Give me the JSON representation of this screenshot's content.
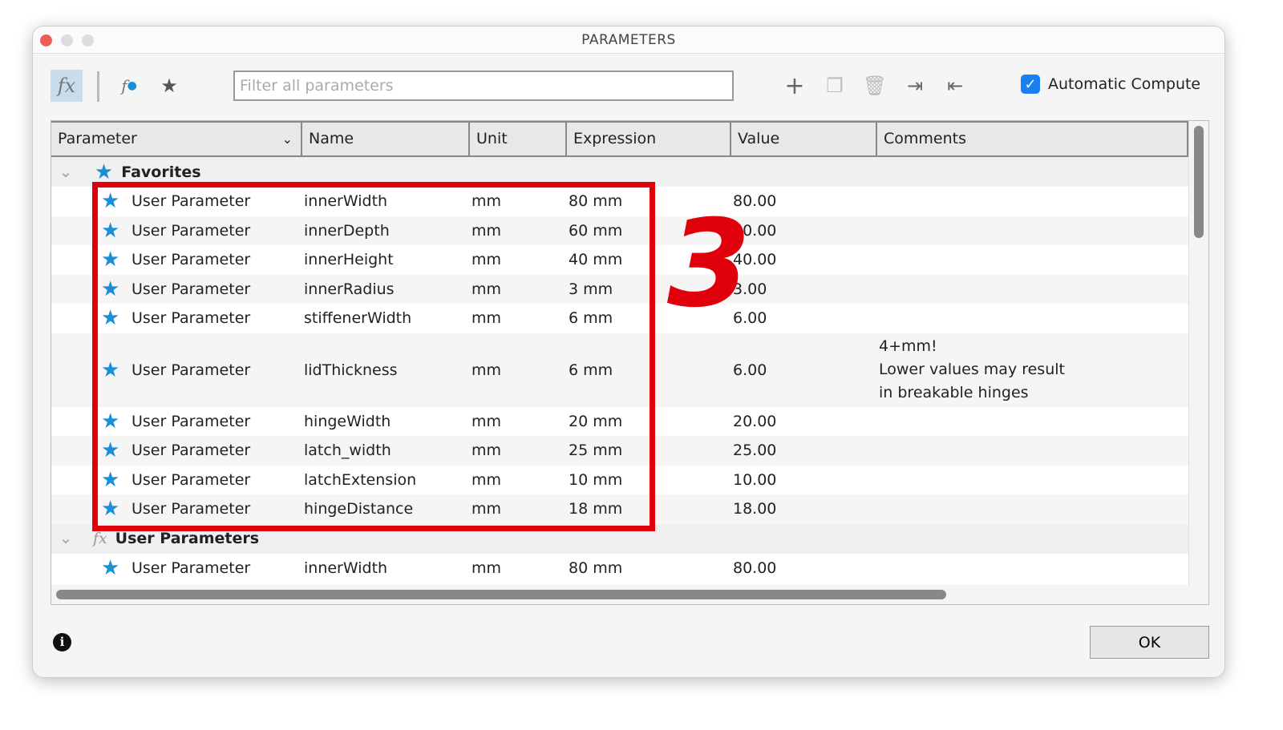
{
  "window": {
    "title": "PARAMETERS"
  },
  "toolbar": {
    "search_placeholder": "Filter all parameters",
    "auto_compute_label": "Automatic Compute",
    "auto_compute_checked": true
  },
  "columns": [
    "Parameter",
    "Name",
    "Unit",
    "Expression",
    "Value",
    "Comments"
  ],
  "groups": {
    "favorites": "Favorites",
    "user": "User Parameters"
  },
  "rows": [
    {
      "type": "User Parameter",
      "name": "innerWidth",
      "unit": "mm",
      "expr": "80 mm",
      "value": "80.00",
      "comment": ""
    },
    {
      "type": "User Parameter",
      "name": "innerDepth",
      "unit": "mm",
      "expr": "60 mm",
      "value": "60.00",
      "comment": ""
    },
    {
      "type": "User Parameter",
      "name": "innerHeight",
      "unit": "mm",
      "expr": "40 mm",
      "value": "40.00",
      "comment": ""
    },
    {
      "type": "User Parameter",
      "name": "innerRadius",
      "unit": "mm",
      "expr": "3 mm",
      "value": "3.00",
      "comment": ""
    },
    {
      "type": "User Parameter",
      "name": "stiffenerWidth",
      "unit": "mm",
      "expr": "6 mm",
      "value": "6.00",
      "comment": ""
    },
    {
      "type": "User Parameter",
      "name": "lidThickness",
      "unit": "mm",
      "expr": "6 mm",
      "value": "6.00",
      "comment": "4+mm!\nLower values may result\nin breakable hinges"
    },
    {
      "type": "User Parameter",
      "name": "hingeWidth",
      "unit": "mm",
      "expr": "20 mm",
      "value": "20.00",
      "comment": ""
    },
    {
      "type": "User Parameter",
      "name": "latch_width",
      "unit": "mm",
      "expr": "25 mm",
      "value": "25.00",
      "comment": ""
    },
    {
      "type": "User Parameter",
      "name": "latchExtension",
      "unit": "mm",
      "expr": "10 mm",
      "value": "10.00",
      "comment": ""
    },
    {
      "type": "User Parameter",
      "name": "hingeDistance",
      "unit": "mm",
      "expr": "18 mm",
      "value": "18.00",
      "comment": ""
    }
  ],
  "user_rows": [
    {
      "type": "User Parameter",
      "name": "innerWidth",
      "unit": "mm",
      "expr": "80 mm",
      "value": "80.00",
      "comment": ""
    }
  ],
  "annotation": {
    "step_number": "3"
  },
  "footer": {
    "ok_label": "OK"
  }
}
